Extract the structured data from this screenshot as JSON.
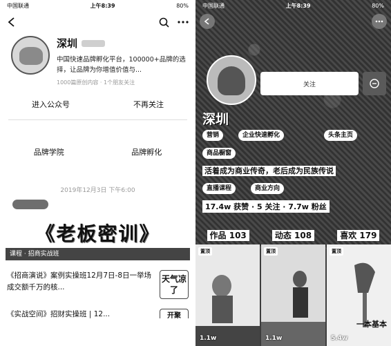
{
  "left": {
    "status": {
      "carrier": "中国联通",
      "time": "上午8:39",
      "battery": "80%"
    },
    "account": {
      "name": "深圳",
      "description": "中国快速品牌孵化平台，100000+品牌的选择，让品牌为你增值价值与...",
      "stats": "1000篇原创内容 · 1个朋友关注"
    },
    "actions": {
      "enter": "进入公众号",
      "unfollow": "不再关注"
    },
    "menu": {
      "item1": "品牌学院",
      "item2": "品牌孵化"
    },
    "date": "2019年12月3日 下午6:00",
    "banner": {
      "title": "《老板密训》",
      "strip": "课程 · 招商实战班"
    },
    "articles": [
      {
        "title": "《招商演说》案例实操班12月7日-8日一举场成交额千万的核...",
        "thumb": "天气凉了"
      },
      {
        "title": "《实战空间》招财实操班 | 12...",
        "thumb": "开聚"
      }
    ]
  },
  "right": {
    "status": {
      "carrier": "中国联通",
      "time": "上午8:39",
      "battery": "80%"
    },
    "follow_placeholder": "关注",
    "name": "深圳",
    "tags": {
      "row1": [
        "营销",
        "企业快速孵化",
        "头条主页"
      ],
      "row2": [
        "商品橱窗"
      ]
    },
    "tagline": "活着成为商业传奇，老后成为民族传说",
    "tags2": [
      "直播课程",
      "商业方向"
    ],
    "stats": "17.4w 获赞 · 5 关注 · 7.7w 粉丝",
    "tabs": [
      {
        "label": "作品 103"
      },
      {
        "label": "动态 108"
      },
      {
        "label": "喜欢 179"
      }
    ],
    "grid": [
      {
        "pin": "置顶",
        "likes": "1.1w",
        "caption": ""
      },
      {
        "pin": "置顶",
        "likes": "1.1w",
        "caption": ""
      },
      {
        "pin": "置顶",
        "likes": "5.4w",
        "caption": "一本基本"
      }
    ]
  }
}
